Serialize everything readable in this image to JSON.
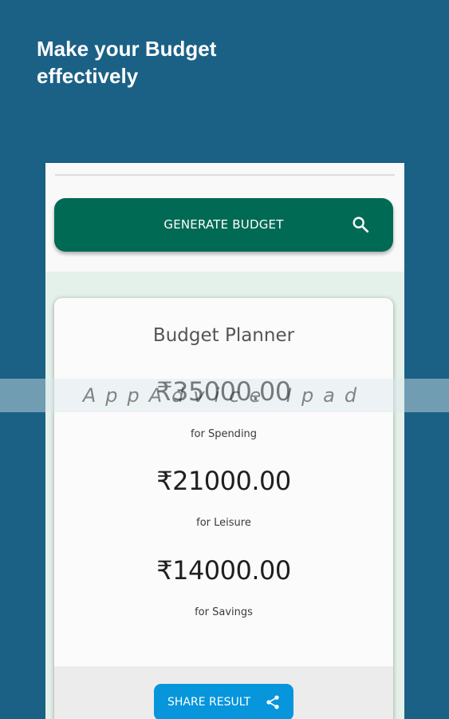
{
  "promo": {
    "headline": "Make your Budget effectively"
  },
  "toolbar": {
    "generate_label": "GENERATE BUDGET",
    "search_icon": "search-icon"
  },
  "card": {
    "title": "Budget Planner",
    "items": [
      {
        "amount": "₹35000.00",
        "label": "for Spending"
      },
      {
        "amount": "₹21000.00",
        "label": "for Leisure"
      },
      {
        "amount": "₹14000.00",
        "label": "for Savings"
      }
    ]
  },
  "share": {
    "label": "SHARE RESULT",
    "icon": "share-icon"
  },
  "watermark": {
    "text": "AppAdvice Ipad"
  },
  "colors": {
    "background": "#1b6186",
    "generate_button": "#006a55",
    "panel": "#e4f1ea",
    "share_button": "#0795db"
  }
}
